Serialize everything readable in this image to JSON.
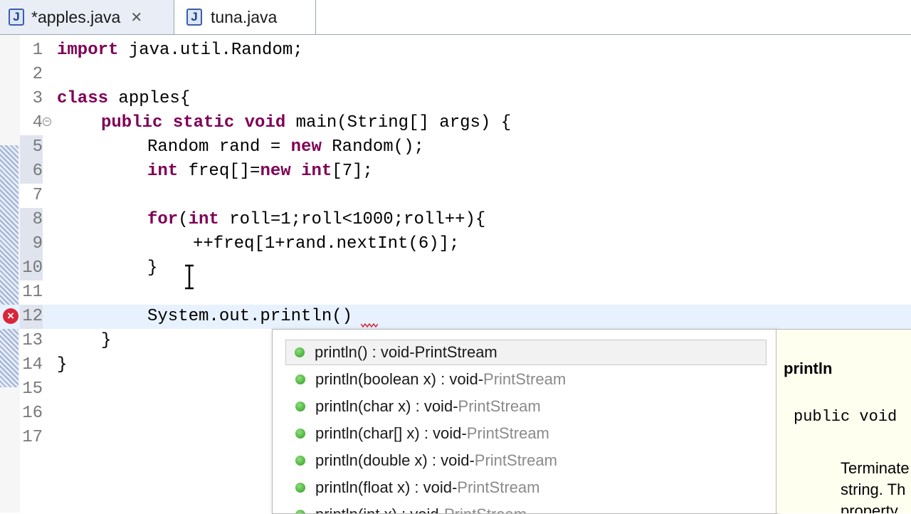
{
  "tabs": [
    {
      "label": "*apples.java",
      "icon": "java-file-icon",
      "active": true
    },
    {
      "label": "tuna.java",
      "icon": "java-file-icon",
      "active": false
    }
  ],
  "tab_close_glyph": "✕",
  "java_icon_glyph": "J",
  "editor": {
    "line_numbers": [
      "1",
      "2",
      "3",
      "4",
      "5",
      "6",
      "7",
      "8",
      "9",
      "10",
      "11",
      "12",
      "13",
      "14",
      "15",
      "16",
      "17"
    ],
    "code": {
      "l1": "java.util.Random;",
      "l1_kw": "import",
      "l3_kw": "class",
      "l3": "apples{",
      "l4_kw": "public static void",
      "l4": "main(String[] args) {",
      "l5a": "Random rand = ",
      "l5_kw": "new",
      "l5b": "Random();",
      "l6_kw1": "int",
      "l6a": "freq[]=",
      "l6_kw2": "new",
      "l6_kw3": "int",
      "l6b": "[7];",
      "l8_kw1": "for",
      "l8_kw2": "int",
      "l8a": "(",
      "l8b": "roll=1;roll<1000;roll++){",
      "l9": "++freq[1+rand.nextInt(6)];",
      "l10": "}",
      "l12": "System.out.println()",
      "l13": "}",
      "l14": "}"
    }
  },
  "content_assist": {
    "items": [
      {
        "signature": "println() : void",
        "owner": "PrintStream"
      },
      {
        "signature": "println(boolean x) : void",
        "owner": "PrintStream"
      },
      {
        "signature": "println(char x) : void",
        "owner": "PrintStream"
      },
      {
        "signature": "println(char[] x) : void",
        "owner": "PrintStream"
      },
      {
        "signature": "println(double x) : void",
        "owner": "PrintStream"
      },
      {
        "signature": "println(float x) : void",
        "owner": "PrintStream"
      },
      {
        "signature": "println(int x) : void",
        "owner": "PrintStream"
      }
    ],
    "separator": " - "
  },
  "javadoc": {
    "title": "println",
    "signature": "public void",
    "description_line1": "Terminate",
    "description_line2": "string. Th",
    "description_line3": "property"
  },
  "colors": {
    "keyword": "#7f0055",
    "error": "#d9263a",
    "current_line": "#e8f2fe",
    "method_dot": "#2f9a25"
  }
}
